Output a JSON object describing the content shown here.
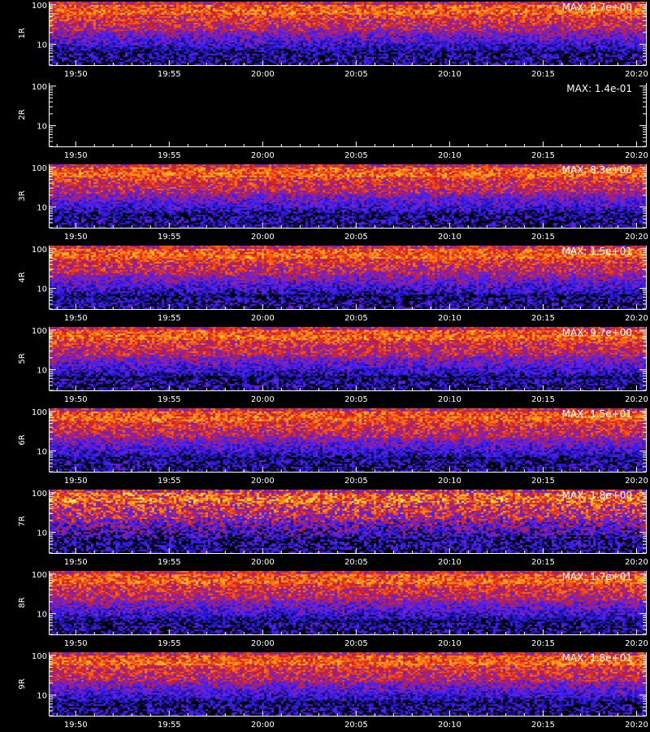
{
  "chart_data": [
    {
      "type": "heatmap",
      "ylabel": "1R",
      "max_label": "MAX: 9.7e+00",
      "yticks": [
        "100",
        "10"
      ],
      "xticks": [
        "19:50",
        "19:55",
        "20:00",
        "20:05",
        "20:10",
        "20:15",
        "20:20"
      ],
      "intensity": "high"
    },
    {
      "type": "heatmap",
      "ylabel": "2R",
      "max_label": "MAX: 1.4e-01",
      "yticks": [
        "100",
        "10"
      ],
      "xticks": [
        "19:50",
        "19:55",
        "20:00",
        "20:05",
        "20:10",
        "20:15",
        "20:20"
      ],
      "intensity": "empty"
    },
    {
      "type": "heatmap",
      "ylabel": "3R",
      "max_label": "MAX: 8.3e+00",
      "yticks": [
        "100",
        "10"
      ],
      "xticks": [
        "19:50",
        "19:55",
        "20:00",
        "20:05",
        "20:10",
        "20:15",
        "20:20"
      ],
      "intensity": "high"
    },
    {
      "type": "heatmap",
      "ylabel": "4R",
      "max_label": "MAX: 1.5e+01",
      "yticks": [
        "100",
        "10"
      ],
      "xticks": [
        "19:50",
        "19:55",
        "20:00",
        "20:05",
        "20:10",
        "20:15",
        "20:20"
      ],
      "intensity": "high"
    },
    {
      "type": "heatmap",
      "ylabel": "5R",
      "max_label": "MAX: 9.7e+00",
      "yticks": [
        "100",
        "10"
      ],
      "xticks": [
        "19:50",
        "19:55",
        "20:00",
        "20:05",
        "20:10",
        "20:15",
        "20:20"
      ],
      "intensity": "high"
    },
    {
      "type": "heatmap",
      "ylabel": "6R",
      "max_label": "MAX: 1.5e+01",
      "yticks": [
        "100",
        "10"
      ],
      "xticks": [
        "19:50",
        "19:55",
        "20:00",
        "20:05",
        "20:10",
        "20:15",
        "20:20"
      ],
      "intensity": "high"
    },
    {
      "type": "heatmap",
      "ylabel": "7R",
      "max_label": "MAX: 1.8e+00",
      "yticks": [
        "100",
        "10"
      ],
      "xticks": [
        "19:50",
        "19:55",
        "20:00",
        "20:05",
        "20:10",
        "20:15",
        "20:20"
      ],
      "intensity": "speckled"
    },
    {
      "type": "heatmap",
      "ylabel": "8R",
      "max_label": "MAX: 1.7e+01",
      "yticks": [
        "100",
        "10"
      ],
      "xticks": [
        "19:50",
        "19:55",
        "20:00",
        "20:05",
        "20:10",
        "20:15",
        "20:20"
      ],
      "intensity": "high"
    },
    {
      "type": "heatmap",
      "ylabel": "9R",
      "max_label": "MAX: 1.8e+01",
      "yticks": [
        "100",
        "10"
      ],
      "xticks": [
        "19:50",
        "19:55",
        "20:00",
        "20:05",
        "20:10",
        "20:15",
        "20:20"
      ],
      "intensity": "high"
    }
  ],
  "colors": {
    "background": "#000000",
    "axis": "#ffffff",
    "colormap": [
      "#000000",
      "#1a10a0",
      "#3a20ff",
      "#8020c0",
      "#d02020",
      "#ff6010",
      "#ffb020",
      "#ffff60"
    ]
  }
}
